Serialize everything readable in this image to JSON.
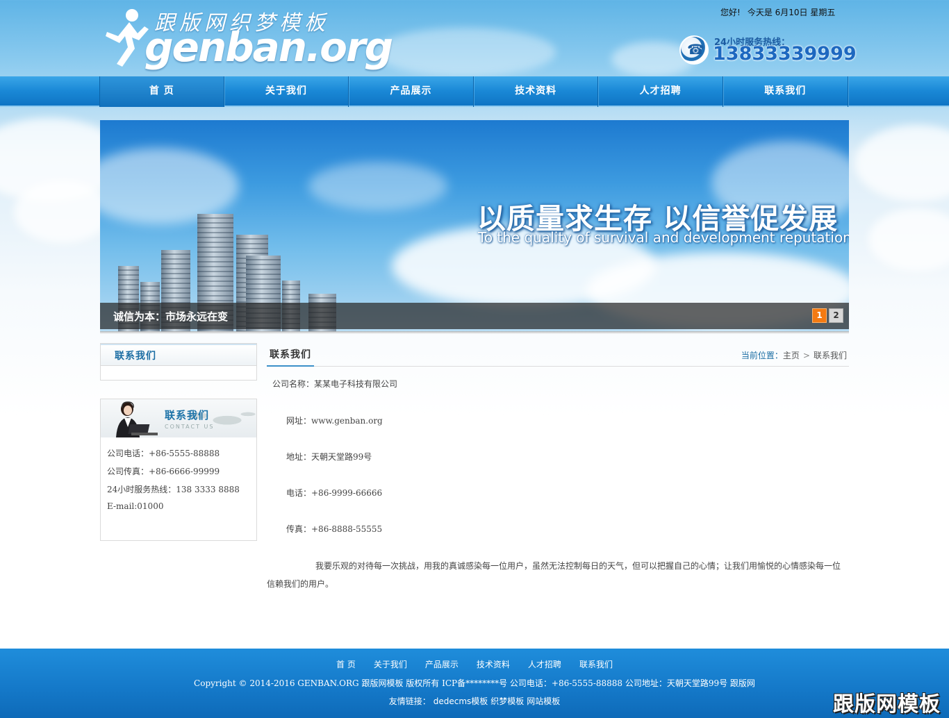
{
  "header": {
    "logo_title": "跟版网织梦模板",
    "logo_domain": "genban.org",
    "greeting": "您好!",
    "date_text": "今天是 6月10日 星期五",
    "hotline_label": "24小时服务热线：",
    "hotline_number": "13833339999"
  },
  "nav": {
    "items": [
      "首 页",
      "关于我们",
      "产品展示",
      "技术资料",
      "人才招聘",
      "联系我们"
    ]
  },
  "banner": {
    "slogan": "以质量求生存 以信誉促发展",
    "subtitle": "To the quality of survival and development reputation",
    "caption": "诚信为本：市场永远在变",
    "pages": [
      "1",
      "2"
    ],
    "active_page": "1"
  },
  "sidebar": {
    "box_title": "联系我们",
    "contact_title": "联系我们",
    "contact_sub": "CONTACT US",
    "lines": [
      "公司电话：+86-5555-88888",
      "公司传真：+86-6666-99999",
      "24小时服务热线：138 3333 8888",
      "E-mail:01000"
    ]
  },
  "main": {
    "title": "联系我们",
    "breadcrumb_label": "当前位置：",
    "breadcrumb_home": "主页",
    "breadcrumb_sep": ">",
    "breadcrumb_current": "联系我们",
    "company": "公司名称：某某电子科技有限公司",
    "website": "网址：www.genban.org",
    "address": "地址：天朝天堂路99号",
    "phone": "电话：+86-9999-66666",
    "fax": "传真：+86-8888-55555",
    "intro": "我要乐观的对待每一次挑战，用我的真诚感染每一位用户，虽然无法控制每日的天气，但可以把握自己的心情；让我们用愉悦的心情感染每一位信赖我们的用户。"
  },
  "footer": {
    "nav": [
      "首 页",
      "关于我们",
      "产品展示",
      "技术资料",
      "人才招聘",
      "联系我们"
    ],
    "copyright": "Copyright © 2014-2016 GENBAN.ORG 跟版网模板 版权所有  ICP备********号  公司电话：+86-5555-88888  公司地址：天朝天堂路99号  跟版网",
    "links_label": "友情链接：",
    "links": [
      "dedecms模板",
      "织梦模板",
      "网站模板"
    ],
    "watermark": "跟版网模板"
  },
  "colors": {
    "nav_blue": "#1a88d6",
    "accent_orange": "#f47a12",
    "footer_blue": "#1478c8",
    "title_blue": "#1b6da3"
  }
}
